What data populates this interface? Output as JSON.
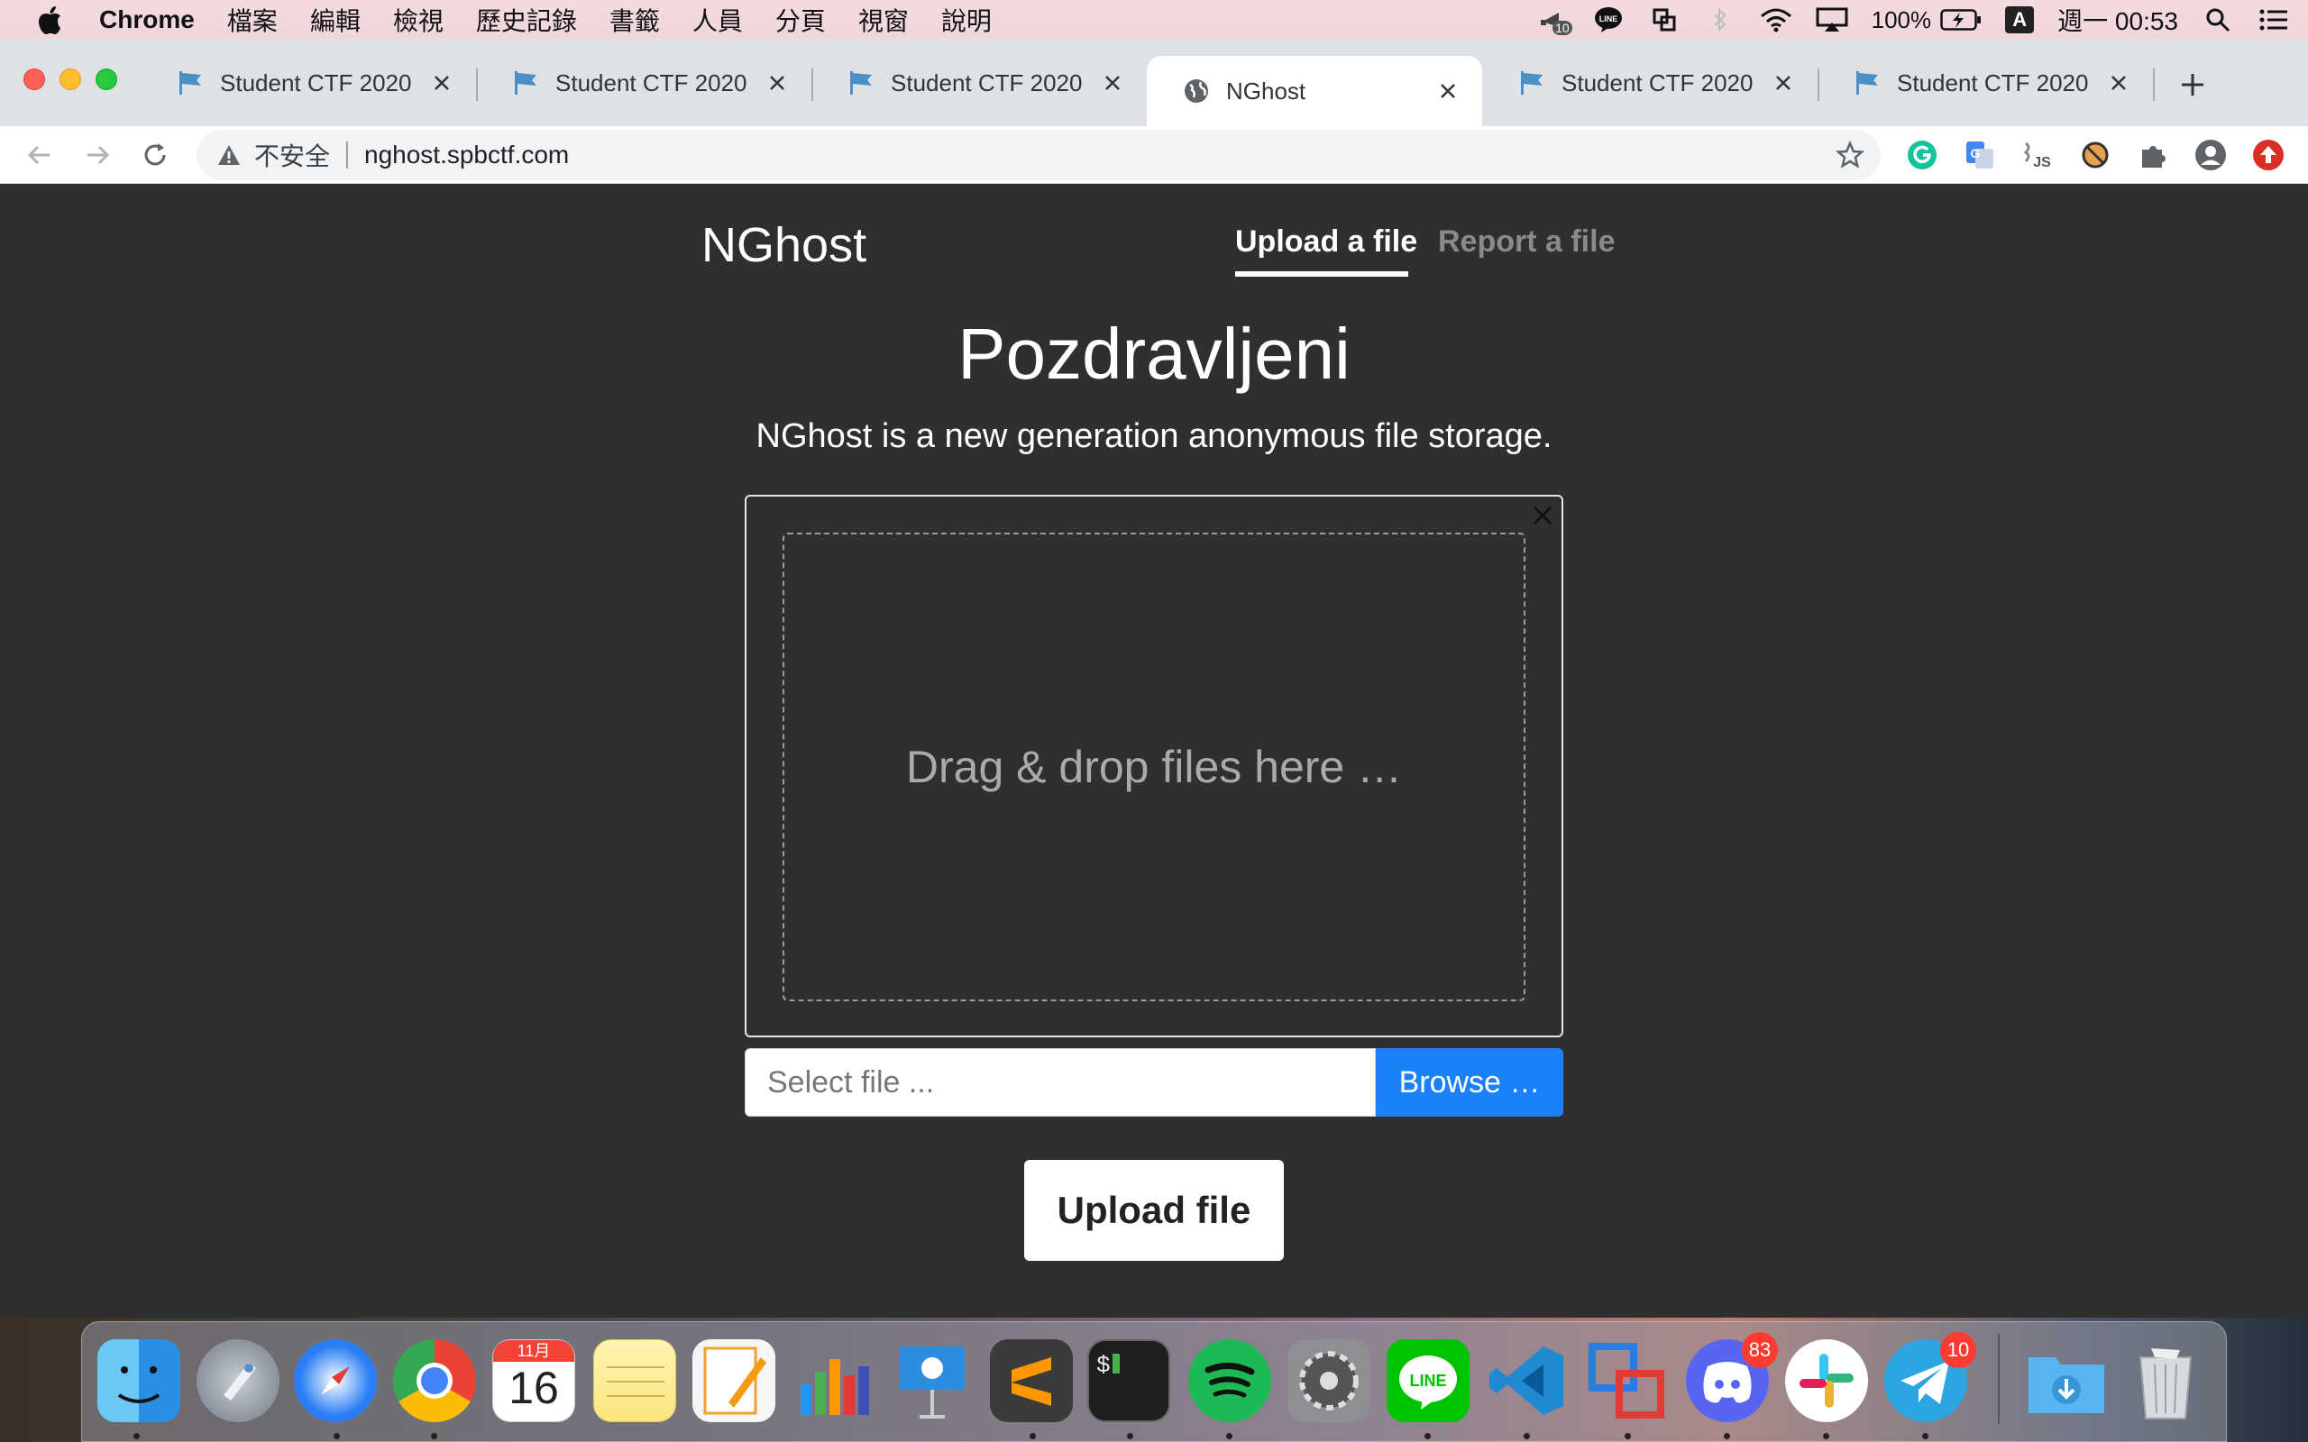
{
  "menubar": {
    "app": "Chrome",
    "items": [
      "檔案",
      "編輯",
      "檢視",
      "歷史記錄",
      "書籤",
      "人員",
      "分頁",
      "視窗",
      "說明"
    ],
    "status_badge": "10",
    "battery": "100%",
    "ime": "A",
    "clock": "週一 00:53"
  },
  "tabs": [
    {
      "title": "Student CTF 2020",
      "icon": "flag-icon"
    },
    {
      "title": "Student CTF 2020",
      "icon": "flag-icon"
    },
    {
      "title": "Student CTF 2020",
      "icon": "flag-icon"
    },
    {
      "title": "NGhost",
      "icon": "globe-icon",
      "active": true
    },
    {
      "title": "Student CTF 2020",
      "icon": "flag-icon"
    },
    {
      "title": "Student CTF 2020",
      "icon": "flag-icon"
    }
  ],
  "omnibox": {
    "security": "不安全",
    "url": "nghost.spbctf.com"
  },
  "page": {
    "brand": "NGhost",
    "nav": {
      "upload": "Upload a file",
      "report": "Report a file"
    },
    "heading": "Pozdravljeni",
    "tagline": "NGhost is a new generation anonymous file storage.",
    "dropzone_text": "Drag & drop files here …",
    "file_placeholder": "Select file ...",
    "browse_label": "Browse …",
    "upload_label": "Upload file"
  },
  "dock": {
    "calendar": {
      "month": "11月",
      "day": "16"
    },
    "badges": {
      "discord": "83",
      "telegram": "10"
    }
  },
  "colors": {
    "page_bg": "#2f2f2f",
    "accent": "#1a81f9"
  }
}
